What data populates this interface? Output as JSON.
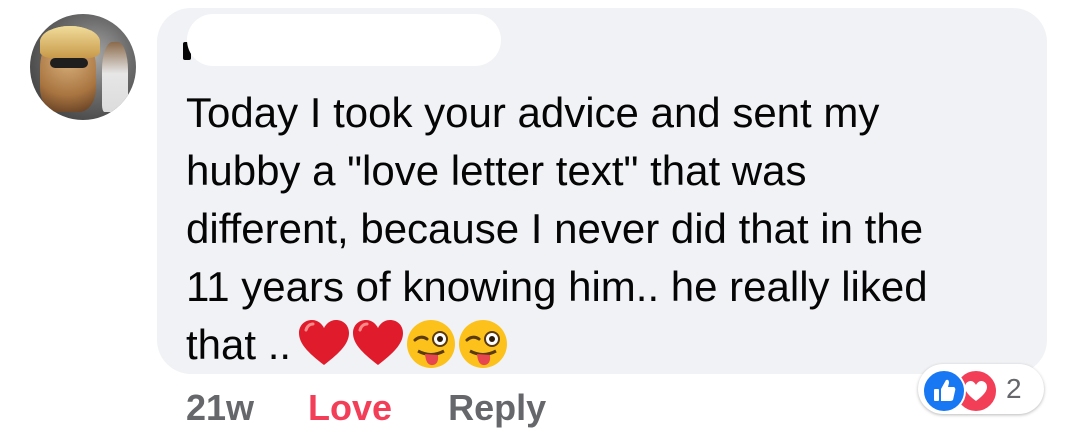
{
  "comment": {
    "author_redacted": true,
    "lines": [
      "Today I took your advice and sent my",
      "hubby a \"love letter text\" that was",
      "different, because I never did that in the",
      "11 years of knowing him.. he really liked",
      "that .."
    ],
    "emojis": [
      "red-heart",
      "red-heart",
      "winking-face-with-tongue",
      "winking-face-with-tongue"
    ]
  },
  "actions": {
    "timestamp": "21w",
    "love_label": "Love",
    "reply_label": "Reply"
  },
  "reactions": {
    "icons": [
      "like-icon",
      "love-icon"
    ],
    "count": "2"
  },
  "colors": {
    "bubble": "#f0f2f5",
    "love_active": "#f33e58",
    "secondary_text": "#65676b",
    "like_blue": "#1877f2"
  }
}
